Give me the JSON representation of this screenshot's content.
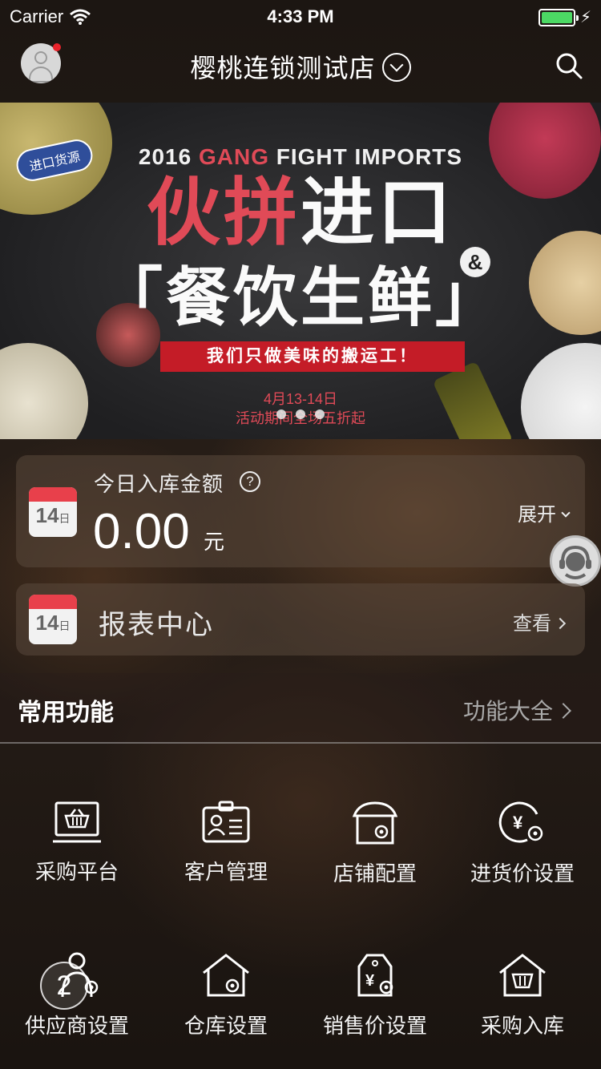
{
  "status_bar": {
    "carrier": "Carrier",
    "time": "4:33 PM",
    "battery_level": 1.0
  },
  "nav": {
    "store_name": "樱桃连锁测试店"
  },
  "banner": {
    "tag": "进口货源",
    "top_line_a": "2016 ",
    "top_line_b": "GANG",
    "top_line_c": " FIGHT IMPORTS",
    "headline_a": "伙拼",
    "headline_b": "进口",
    "amp": "&",
    "sub": "「餐饮生鲜」",
    "ribbon": "我们只做美味的搬运工！",
    "date": "4月13-14日",
    "promo": "活动期间全场五折起",
    "slide_count": 3
  },
  "amount_card": {
    "calendar_day": "14",
    "calendar_unit": "日",
    "label": "今日入库金额",
    "help": "?",
    "value": "0.00",
    "unit": "元",
    "expand": "展开"
  },
  "report_card": {
    "calendar_day": "14",
    "calendar_unit": "日",
    "title": "报表中心",
    "view": "查看"
  },
  "common_functions": {
    "title": "常用功能",
    "more": "功能大全",
    "items": [
      {
        "label": "采购平台",
        "icon": "purchase-platform-icon"
      },
      {
        "label": "客户管理",
        "icon": "customer-card-icon"
      },
      {
        "label": "店铺配置",
        "icon": "store-settings-icon"
      },
      {
        "label": "进货价设置",
        "icon": "purchase-price-icon"
      },
      {
        "label": "供应商设置",
        "icon": "supplier-settings-icon"
      },
      {
        "label": "仓库设置",
        "icon": "warehouse-settings-icon"
      },
      {
        "label": "销售价设置",
        "icon": "sale-price-icon"
      },
      {
        "label": "采购入库",
        "icon": "purchase-inbound-icon"
      }
    ]
  },
  "colors": {
    "accent_red": "#e8404b",
    "battery_green": "#4cd964",
    "dot_red": "#e8232b"
  }
}
